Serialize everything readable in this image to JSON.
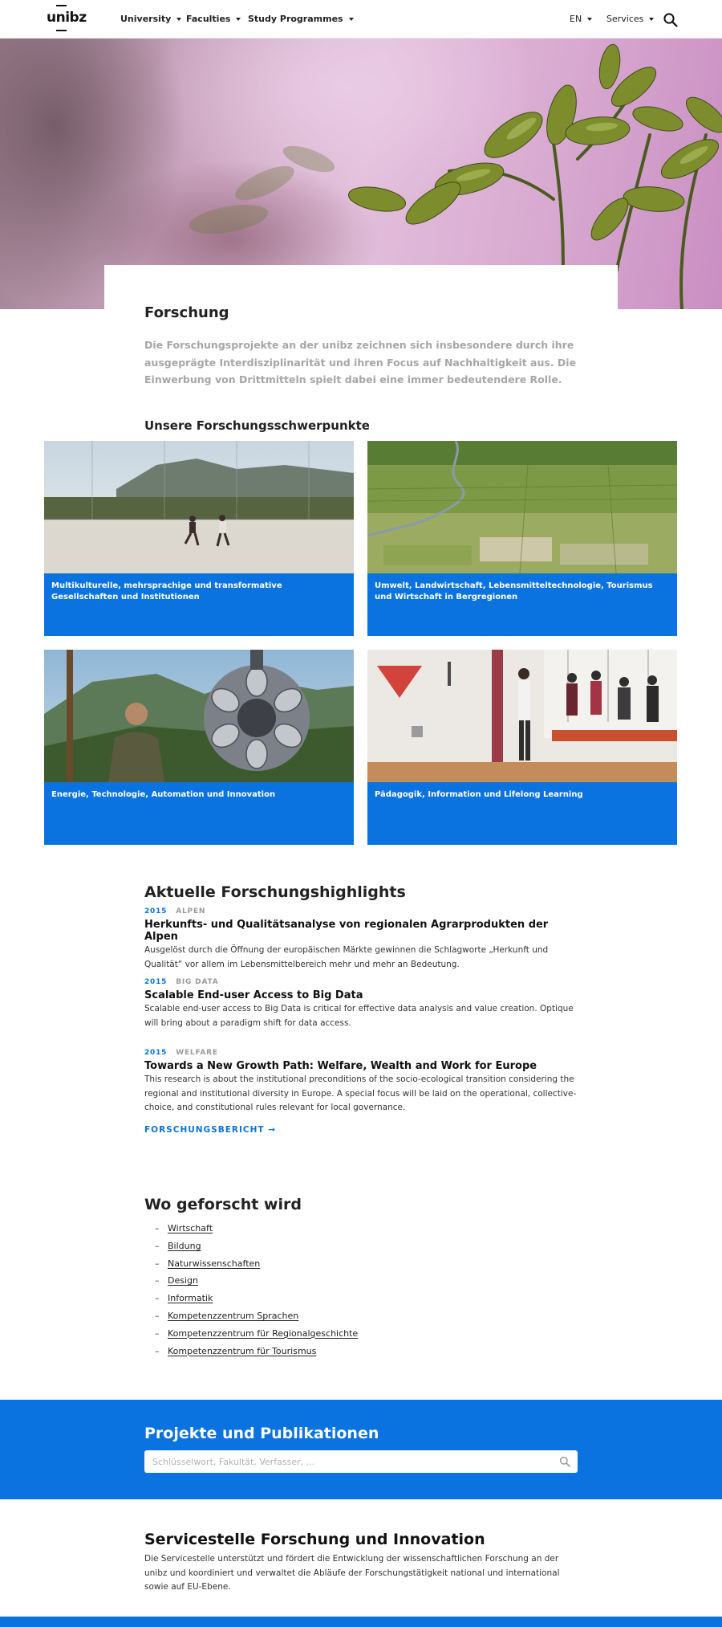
{
  "header": {
    "logo_text": "unibz",
    "nav": [
      {
        "label": "University"
      },
      {
        "label": "Faculties"
      },
      {
        "label": "Study Programmes"
      }
    ],
    "language": "EN",
    "services": "Services"
  },
  "intro": {
    "title": "Forschung",
    "text": "Die Forschungsprojekte an der unibz zeichnen sich insbesondere durch ihre ausgeprägte Interdisziplinarität und ihren Focus auf Nachhaltigkeit aus. Die Einwerbung von Drittmitteln spielt dabei eine immer bedeutendere Rolle."
  },
  "focus": {
    "title": "Unsere Forschungsschwerpunkte",
    "cards": [
      {
        "label": "Multikulturelle, mehrsprachige und transformative Gesellschaften und Institutionen"
      },
      {
        "label": "Umwelt, Landwirtschaft, Lebensmitteltechnologie, Tourismus und Wirtschaft in Bergregionen"
      },
      {
        "label": "Energie, Technologie, Automation und Innovation"
      },
      {
        "label": "Pädagogik, Information und Lifelong Learning"
      }
    ]
  },
  "highlights": {
    "title": "Aktuelle Forschungshighlights",
    "items": [
      {
        "year": "2015",
        "category": "ALPEN",
        "headline": "Herkunfts- und Qualitätsanalyse von regionalen Agrarprodukten der Alpen",
        "body": "Ausgelöst durch die Öffnung der europäischen Märkte gewinnen die Schlagworte „Herkunft und Qualität“ vor allem im Lebensmittelbereich mehr und mehr an Bedeutung."
      },
      {
        "year": "2015",
        "category": "BIG DATA",
        "headline": "Scalable End-user Access to Big Data",
        "body": "Scalable end-user access to Big Data is critical for effective data analysis and value creation. Optique will bring about a paradigm shift for data access."
      },
      {
        "year": "2015",
        "category": "WELFARE",
        "headline": "Towards a New Growth Path: Welfare, Wealth and Work for Europe",
        "body": "This research is about the institutional preconditions of the socio-ecological transition considering the regional and institutional diversity in Europe. A special focus will be laid on the operational, collective-choice, and constitutional rules relevant for local governance."
      }
    ],
    "report_link": "FORSCHUNGSBERICHT →"
  },
  "research_places": {
    "title": "Wo geforscht wird",
    "items": [
      "Wirtschaft",
      "Bildung",
      "Naturwissenschaften",
      "Design",
      "Informatik",
      "Kompetenzzentrum Sprachen",
      "Kompetenzzentrum für Regionalgeschichte",
      "Kompetenzzentrum für Tourismus"
    ]
  },
  "projects": {
    "title": "Projekte und Publikationen",
    "search_placeholder": "Schlüsselwort, Fakultät, Verfasser, ..."
  },
  "service": {
    "title": "Servicestelle Forschung und Innovation",
    "text": "Die Servicestelle unterstützt und fördert die Entwicklung der wissenschaftlichen Forschung an der unibz und koordiniert und verwaltet die Abläufe der Forschungstätigkeit national und international sowie auf EU-Ebene."
  },
  "colors": {
    "brand_blue": "#0a73e0",
    "intro_gray": "#a6a6a6"
  }
}
